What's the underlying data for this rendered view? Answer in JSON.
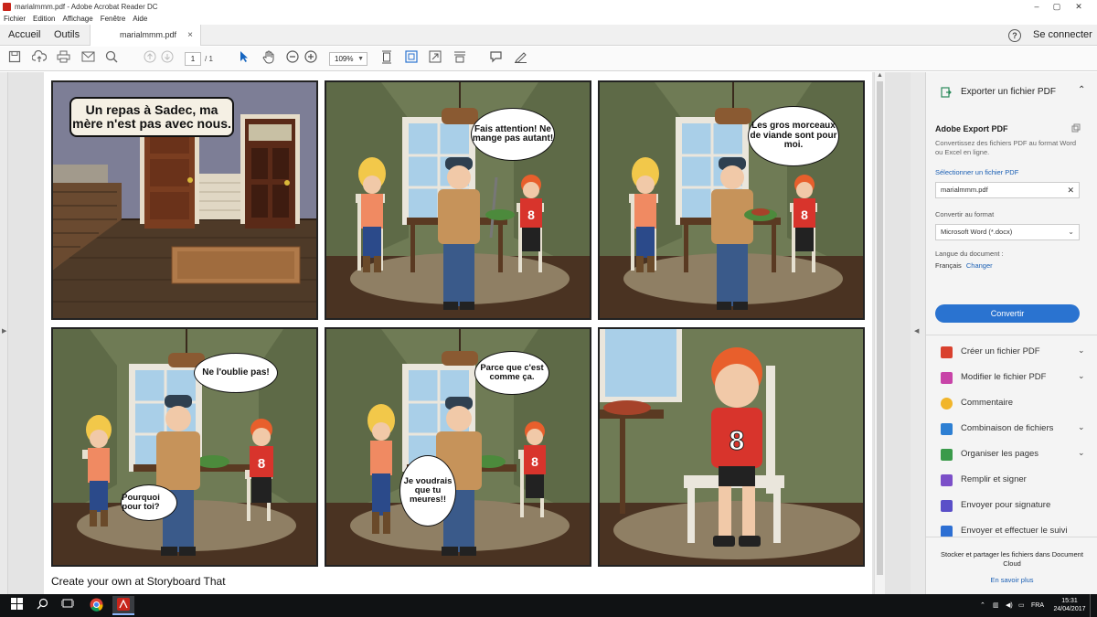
{
  "window": {
    "title": "marialmmm.pdf - Adobe Acrobat Reader DC",
    "controls": [
      "–",
      "▢",
      "✕"
    ]
  },
  "menu": [
    "Fichier",
    "Edition",
    "Affichage",
    "Fenêtre",
    "Aide"
  ],
  "tabs": {
    "home": "Accueil",
    "tools": "Outils",
    "document": "marialmmm.pdf",
    "close": "×",
    "help": "?",
    "signin": "Se connecter"
  },
  "toolbar": {
    "page_current": "1",
    "page_total": "/ 1",
    "zoom": "109%",
    "icons": [
      "save-icon",
      "cloud-upload-icon",
      "print-icon",
      "email-icon",
      "search-icon",
      "prev-page-icon",
      "next-page-icon",
      "select-cursor-icon",
      "hand-icon",
      "zoom-out-icon",
      "zoom-in-icon",
      "fit-page-icon",
      "full-screen-icon",
      "rotate-icon",
      "scroll-mode-icon",
      "comment-icon",
      "sign-pen-icon"
    ]
  },
  "comic": {
    "caption": "Un repas à Sadec, ma mère n'est pas avec nous.",
    "bubbles": {
      "p2": "Fais attention! Ne mange pas autant!",
      "p3": "Les gros morceaux de viande sont pour moi.",
      "p4a": "Ne l'oublie pas!",
      "p4b": "Pourquoi pour toi?",
      "p5a": "Parce que c'est comme ça.",
      "p5b": "Je voudrais que tu meures!!"
    },
    "footer": "Create your own at Storyboard That"
  },
  "right_panel": {
    "export_heading": "Exporter un fichier PDF",
    "title": "Adobe Export PDF",
    "description": "Convertissez des fichiers PDF au format Word ou Excel en ligne.",
    "select_file_link": "Sélectionner un fichier PDF",
    "file_value": "marialmmm.pdf",
    "convert_to_label": "Convertir au format",
    "format_value": "Microsoft Word (*.docx)",
    "language_label": "Langue du document :",
    "language_value": "Français",
    "change_link": "Changer",
    "convert_button": "Convertir",
    "tools": [
      {
        "label": "Créer un fichier PDF",
        "color": "#d9412e",
        "chevron": true
      },
      {
        "label": "Modifier le fichier PDF",
        "color": "#c844a8",
        "chevron": true
      },
      {
        "label": "Commentaire",
        "color": "#f1b52a",
        "chevron": false
      },
      {
        "label": "Combinaison de fichiers",
        "color": "#2d7fd3",
        "chevron": true
      },
      {
        "label": "Organiser les pages",
        "color": "#3a9a4a",
        "chevron": true
      },
      {
        "label": "Remplir et signer",
        "color": "#7b4fc8",
        "chevron": false
      },
      {
        "label": "Envoyer pour signature",
        "color": "#5a4fc8",
        "chevron": false
      },
      {
        "label": "Envoyer et effectuer le suivi",
        "color": "#2d6fd3",
        "chevron": false
      }
    ],
    "footer_text": "Stocker et partager les fichiers dans Document Cloud",
    "footer_link": "En savoir plus"
  },
  "taskbar": {
    "language": "FRA",
    "time": "15:31",
    "date": "24/04/2017"
  }
}
